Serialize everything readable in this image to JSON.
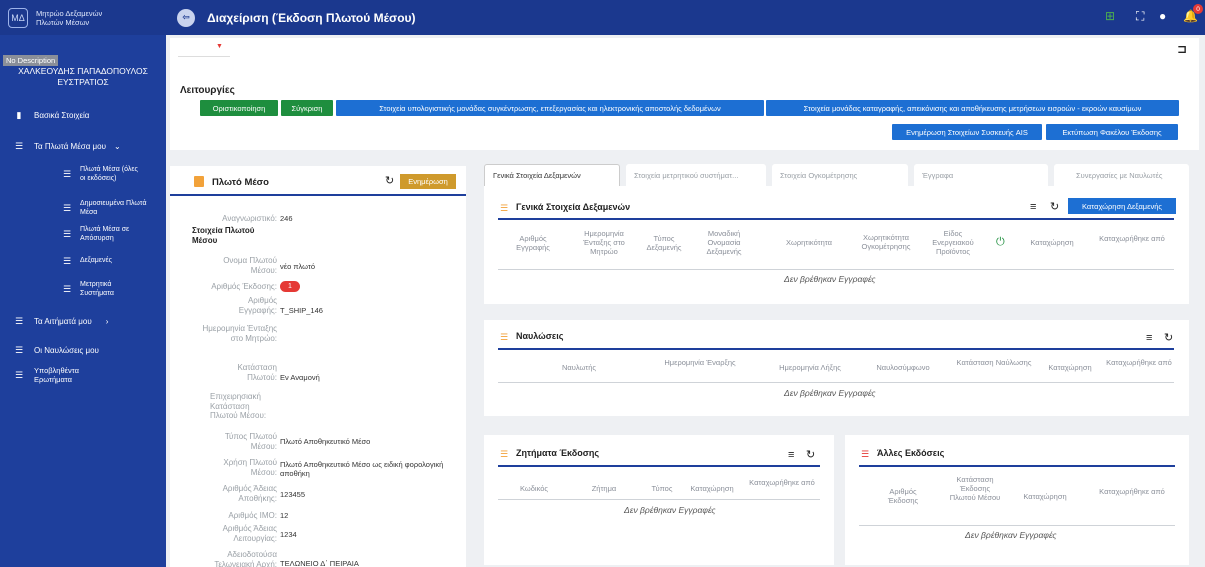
{
  "sidebar": {
    "logo_text": "ΜΔ",
    "app_title": "Μητρώο Δεξαμενών Πλωτών Μέσων",
    "no_description": "No Description",
    "user_name": "ΧΑΛΚΕΟΥΔΗΣ ΠΑΠΑΔΟΠΟΥΛΟΣ ΕΥΣΤΡΑΤΙΟΣ",
    "items": [
      {
        "label": "Βασικά Στοιχεία"
      },
      {
        "label": "Τα Πλωτά Μέσα μου"
      },
      {
        "label": "Πλωτά Μέσα (όλες οι εκδόσεις)"
      },
      {
        "label": "Δημοσιευμένα Πλωτά Μέσα"
      },
      {
        "label": "Πλωτά Μέσα σε Απόσυρση"
      },
      {
        "label": "Δεξαμενές"
      },
      {
        "label": "Μετρητικά Συστήματα"
      },
      {
        "label": "Τα Αιτήματά μου"
      },
      {
        "label": "Οι Ναυλώσεις μου"
      },
      {
        "label": "Υποβληθέντα Ερωτήματα"
      }
    ]
  },
  "topbar": {
    "title": "Διαχείριση (Έκδοση Πλωτού Μέσου)",
    "notification_count": "0"
  },
  "functions": {
    "title": "Λειτουργίες",
    "buttons": [
      "Οριστικοποίηση",
      "Σύγκριση",
      "Στοιχεία υπολογιστικής μονάδας συγκέντρωσης, επεξεργασίας και ηλεκτρονικής αποστολής δεδομένων",
      "Στοιχεία μονάδας καταγραφής, απεικόνισης και αποθήκευσης μετρήσεων εισροών - εκροών καυσίμων",
      "Ενημέρωση Στοιχείων Συσκευής AIS",
      "Εκτύπωση Φακέλου Έκδοσης"
    ]
  },
  "vessel_card": {
    "title": "Πλωτό Μέσο",
    "update_label": "Ενημέρωση",
    "id_label": "Αναγνωριστικό:",
    "id_value": "246",
    "section": "Στοιχεία Πλωτού Μέσου",
    "fields": [
      {
        "label": "Ονομα Πλωτού Μέσου:",
        "value": "νέο πλωτό"
      },
      {
        "label": "Αριθμός Έκδοσης:",
        "value": "1"
      },
      {
        "label": "Αριθμός Εγγραφής:",
        "value": "T_SHIP_146"
      },
      {
        "label": "Ημερομηνία Ένταξης στο Μητρώο:",
        "value": ""
      },
      {
        "label": "Κατάσταση Πλωτού:",
        "value": "Εν Αναμονή"
      },
      {
        "label": "Επιχειρησιακή Κατάσταση Πλωτού Μέσου:",
        "value": ""
      },
      {
        "label": "Τύπος Πλωτού Μέσου:",
        "value": "Πλωτό Αποθηκευτικό Μέσο"
      },
      {
        "label": "Χρήση Πλωτού Μέσου:",
        "value": "Πλωτό Αποθηκευτικό Μέσο ως ειδική φορολογική αποθήκη"
      },
      {
        "label": "Αριθμός Άδειας Αποθήκης:",
        "value": "123455"
      },
      {
        "label": "Αριθμός IMO:",
        "value": "12"
      },
      {
        "label": "Αριθμός Άδειας Λειτουργίας:",
        "value": "1234"
      },
      {
        "label": "Αδειοδοτούσα Τελωνειακή Αρχή:",
        "value": "ΤΕΛΩΝΕΙΟ Δ΄ ΠΕΙΡΑΙΑ"
      }
    ]
  },
  "tabs": [
    "Γενικά Στοιχεία Δεξαμενών",
    "Στοιχεία μετρητικού συστήματ...",
    "Στοιχεία Ογκομέτρησης",
    "Έγγραφα",
    "Συνεργασίες με Ναυλωτές"
  ],
  "tanks": {
    "title": "Γενικά Στοιχεία Δεξαμενών",
    "add_label": "Καταχώρηση Δεξαμενής",
    "columns": [
      "Αριθμός Εγγραφής",
      "Ημερομηνία Ένταξης στο Μητρώο",
      "Τύπος Δεξαμενής",
      "Μοναδική Ονομασία Δεξαμενής",
      "Χωρητικότητα",
      "Χωρητικότητα Ογκομέτρησης",
      "Είδος Ενεργειακού Προϊόντος",
      "Καταχώρηση",
      "Καταχωρήθηκε από"
    ],
    "empty": "Δεν βρέθηκαν Εγγραφές"
  },
  "charters": {
    "title": "Ναυλώσεις",
    "columns": [
      "Ναυλωτής",
      "Ημερομηνία Έναρξης",
      "Ημερομηνία Λήξης",
      "Ναυλοσύμφωνο",
      "Κατάσταση Ναύλωσης",
      "Καταχώρηση",
      "Καταχωρήθηκε από"
    ],
    "empty": "Δεν βρέθηκαν Εγγραφές"
  },
  "issues": {
    "title": "Ζητήματα Έκδοσης",
    "columns": [
      "Κωδικός",
      "Ζήτημα",
      "Τύπος",
      "Καταχώρηση",
      "Καταχωρήθηκε από"
    ],
    "empty": "Δεν βρέθηκαν Εγγραφές"
  },
  "versions": {
    "title": "Άλλες Εκδόσεις",
    "columns": [
      "Αριθμός Έκδοσης",
      "Κατάσταση Έκδοσης Πλωτού Μέσου",
      "Καταχώρηση",
      "Καταχωρήθηκε από"
    ],
    "empty": "Δεν βρέθηκαν Εγγραφές"
  },
  "colors": {
    "sidebar": "#1e3f9c",
    "topbar": "#1b388e",
    "green_button": "#1e8e3e",
    "blue_button": "#1d6fd3",
    "update_button": "#cf9a2c",
    "badge": "#e53935"
  }
}
